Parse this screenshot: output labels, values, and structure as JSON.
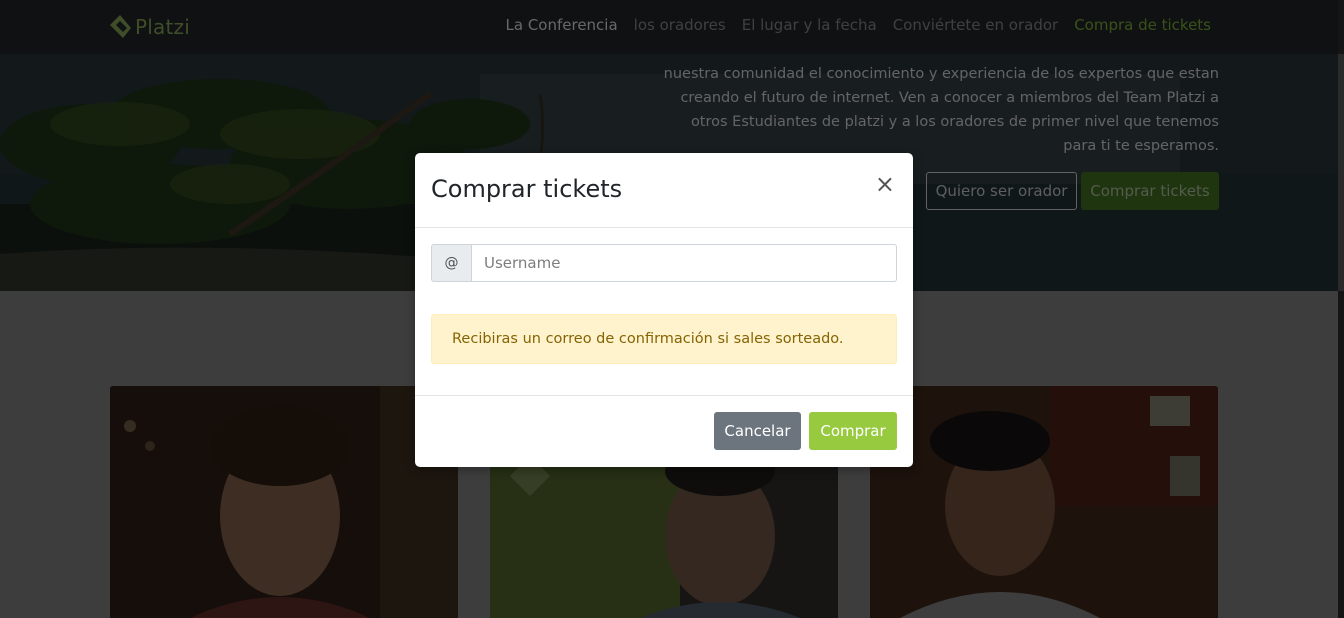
{
  "navbar": {
    "brand": "Platzi",
    "links": [
      {
        "label": "La Conferencia"
      },
      {
        "label": "los oradores"
      },
      {
        "label": "El lugar y la fecha"
      },
      {
        "label": "Conviértete en orador"
      },
      {
        "label": "Compra de tickets"
      }
    ]
  },
  "hero": {
    "lines": [
      "nuestra comunidad el conocimiento y experiencia de los expertos que estan",
      "creando el futuro de internet. Ven a conocer a miembros del Team Platzi a",
      "otros Estudiantes de platzi y a los oradores de primer nivel que tenemos",
      "para ti te esperamos."
    ],
    "btn_outline": "Quiero ser orador",
    "btn_green": "Comprar tickets"
  },
  "modal": {
    "title": "Comprar tickets",
    "close": "×",
    "addon": "@",
    "username_placeholder": "Username",
    "alert": "Recibiras un correo de confirmación si sales sorteado.",
    "cancel": "Cancelar",
    "buy": "Comprar"
  },
  "colors": {
    "accent": "#98ca3f",
    "navbar": "#1f2326",
    "cancel": "#6c757d",
    "alert_bg": "#fff3cd",
    "alert_text": "#856404"
  }
}
